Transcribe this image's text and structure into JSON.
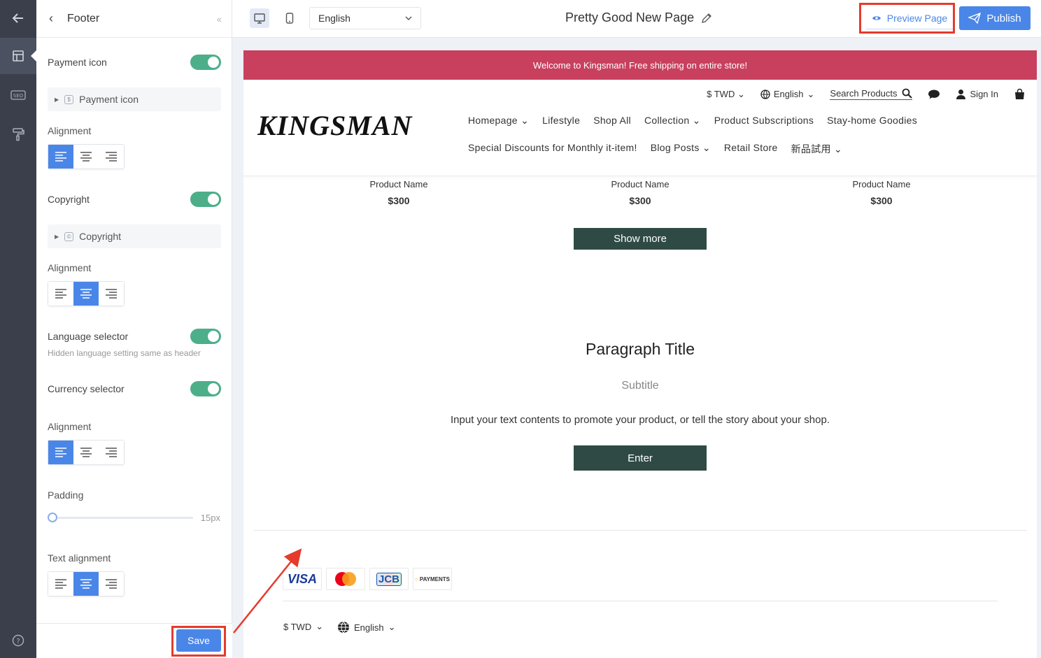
{
  "panel": {
    "title": "Footer",
    "payment_icon_label": "Payment icon",
    "payment_icon_item": "Payment icon",
    "alignment_label": "Alignment",
    "copyright_label": "Copyright",
    "copyright_item": "Copyright",
    "language_selector_label": "Language selector",
    "language_selector_hint": "Hidden language setting same as header",
    "currency_selector_label": "Currency selector",
    "padding_label": "Padding",
    "padding_value": "15px",
    "padding_level": 0,
    "text_alignment_label": "Text alignment",
    "save_label": "Save"
  },
  "topbar": {
    "language": "English",
    "page_title": "Pretty Good New Page",
    "preview_label": "Preview Page",
    "publish_label": "Publish"
  },
  "store": {
    "banner": "Welcome to Kingsman! Free shipping on entire store!",
    "currency": "$ TWD",
    "language": "English",
    "search_label": "Search Products",
    "signin_label": "Sign In",
    "logo": "KINGSMAN",
    "nav": [
      "Homepage",
      "Lifestyle",
      "Shop All",
      "Collection",
      "Product Subscriptions",
      "Stay-home Goodies",
      "Special Discounts for Monthly it-item!",
      "Blog Posts",
      "Retail Store",
      "新品試用"
    ],
    "products": [
      {
        "name": "Product Name",
        "price": "$300"
      },
      {
        "name": "Product Name",
        "price": "$300"
      },
      {
        "name": "Product Name",
        "price": "$300"
      }
    ],
    "show_more": "Show more",
    "paragraph_title": "Paragraph Title",
    "subtitle": "Subtitle",
    "body": "Input your text contents to promote your product, or tell the story about your shop.",
    "enter": "Enter",
    "payments": [
      "VISA",
      "JCB",
      "PAYMENTS"
    ],
    "footer_currency": "$ TWD",
    "footer_language": "English"
  },
  "colors": {
    "accent": "#4a86e8",
    "toggle_on": "#4caf8a",
    "banner": "#c8405e",
    "dark_button": "#2f4a45",
    "highlight": "#e53b2c"
  }
}
